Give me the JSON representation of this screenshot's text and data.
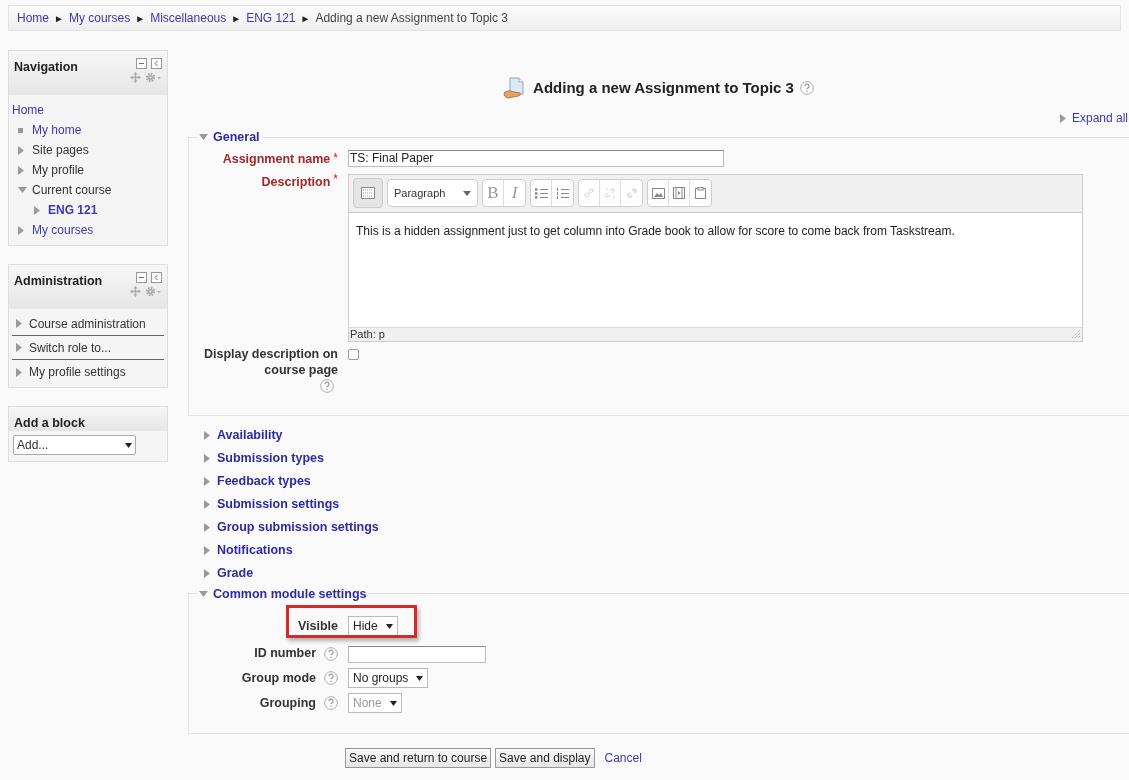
{
  "breadcrumb": [
    {
      "label": "Home",
      "kind": "link"
    },
    {
      "label": "My courses",
      "kind": "link"
    },
    {
      "label": "Miscellaneous",
      "kind": "link"
    },
    {
      "label": "ENG 121",
      "kind": "link"
    },
    {
      "label": "Adding a new Assignment to Topic 3",
      "kind": "current"
    }
  ],
  "separator": "►",
  "navigation": {
    "title": "Navigation",
    "items": [
      {
        "label": "Home",
        "kind": "link",
        "link": true,
        "selected": false,
        "children": [
          {
            "label": "My home",
            "kind": "leaf",
            "link": true,
            "selected": false
          },
          {
            "label": "Site pages",
            "kind": "branch",
            "expanded": false,
            "link": false,
            "selected": false
          },
          {
            "label": "My profile",
            "kind": "branch",
            "expanded": false,
            "link": false,
            "selected": false
          },
          {
            "label": "Current course",
            "kind": "branch",
            "expanded": true,
            "link": false,
            "selected": false,
            "children": [
              {
                "label": "ENG 121",
                "kind": "branch",
                "expanded": false,
                "link": true,
                "selected": true
              }
            ]
          },
          {
            "label": "My courses",
            "kind": "branch",
            "expanded": false,
            "link": true,
            "selected": false
          }
        ]
      }
    ]
  },
  "administration": {
    "title": "Administration",
    "items": [
      {
        "label": "Course administration",
        "expanded": false
      },
      {
        "label": "Switch role to...",
        "expanded": false
      },
      {
        "label": "My profile settings",
        "expanded": false
      }
    ]
  },
  "add_block": {
    "title": "Add a block",
    "select": "Add..."
  },
  "page_title": "Adding a new Assignment to Topic 3",
  "expand_all": "Expand all",
  "sections": [
    {
      "title": "General",
      "expanded": true,
      "fields": [
        {
          "kind": "text",
          "label": "Assignment name",
          "mark": "*",
          "value": "TS: Final Paper"
        },
        {
          "kind": "editor",
          "label": "Description",
          "mark": "*",
          "toolbar": {
            "style": "Paragraph",
            "bold": "B",
            "italic": "I",
            "links_disabled": true
          },
          "value": "This is a hidden assignment just to get column into Grade book to allow for score to come back from Taskstream.",
          "path": "Path: p"
        },
        {
          "kind": "checkbox",
          "label": "Display description on course page",
          "checked": false,
          "help": true
        }
      ]
    },
    {
      "title": "Availability",
      "expanded": false
    },
    {
      "title": "Submission types",
      "expanded": false
    },
    {
      "title": "Feedback types",
      "expanded": false
    },
    {
      "title": "Submission settings",
      "expanded": false
    },
    {
      "title": "Group submission settings",
      "expanded": false
    },
    {
      "title": "Notifications",
      "expanded": false
    },
    {
      "title": "Grade",
      "expanded": false
    },
    {
      "title": "Common module settings",
      "expanded": true,
      "fields": [
        {
          "kind": "select",
          "label": "Visible",
          "value": "Hide",
          "highlighted": true,
          "disabled": false
        },
        {
          "kind": "text",
          "label": "ID number",
          "help": true
        },
        {
          "kind": "select",
          "label": "Group mode",
          "value": "No groups",
          "help": true,
          "highlighted": false,
          "disabled": false
        },
        {
          "kind": "select",
          "label": "Grouping",
          "value": "None",
          "help": true,
          "highlighted": false,
          "disabled": true
        }
      ]
    }
  ],
  "buttons": [
    {
      "label": "Save and return to course",
      "kind": "button"
    },
    {
      "label": "Save and display",
      "kind": "button"
    },
    {
      "label": "Cancel",
      "kind": "link"
    }
  ]
}
